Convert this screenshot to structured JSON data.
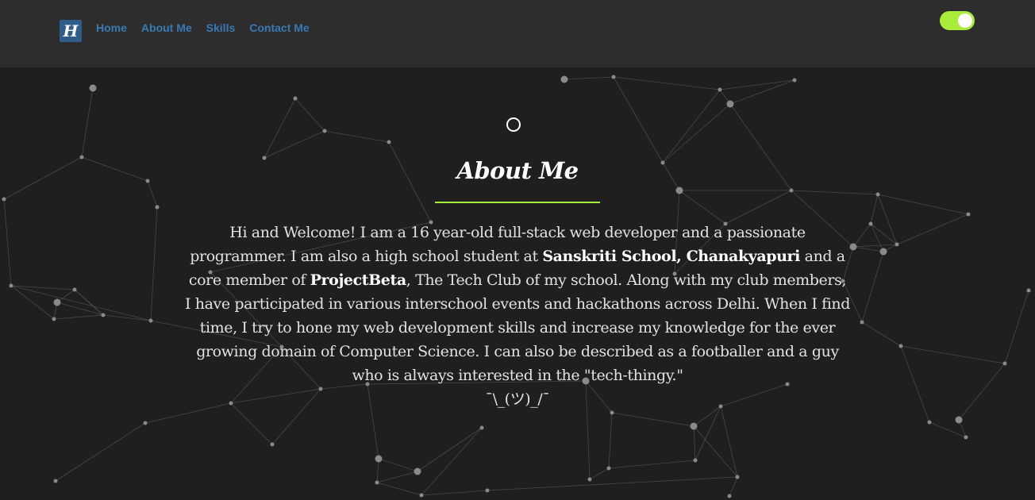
{
  "nav": {
    "logo_letter": "H",
    "links": [
      "Home",
      "About Me",
      "Skills",
      "Contact Me"
    ]
  },
  "theme_toggle": {
    "state": "on",
    "color": "#a9ec3b"
  },
  "section": {
    "title": "About Me",
    "accent_color": "#a9ec3b"
  },
  "about": {
    "p1": "Hi and Welcome! I am a 16 year-old full-stack web developer and a passionate programmer. I am also a high school student at ",
    "school": "Sanskriti School, Chanakyapuri",
    "p2": " and a core member of ",
    "club": "ProjectBeta",
    "p3": ", The Tech Club of my school. Along with my club members, I have participated in various interschool events and hackathons across Delhi. When I find time, I try to hone my web development skills and increase my knowledge for the ever growing domain of Computer Science. I can also be described as a footballer and a guy who is always interested in the \"tech-thingy.\"",
    "shrug": "¯\\_(ツ)_/¯"
  },
  "colors": {
    "background": "#1f1f1f",
    "navbar": "#2d2d2d",
    "nav_link": "#3b79b4",
    "logo_bg": "#2e5d8a"
  }
}
